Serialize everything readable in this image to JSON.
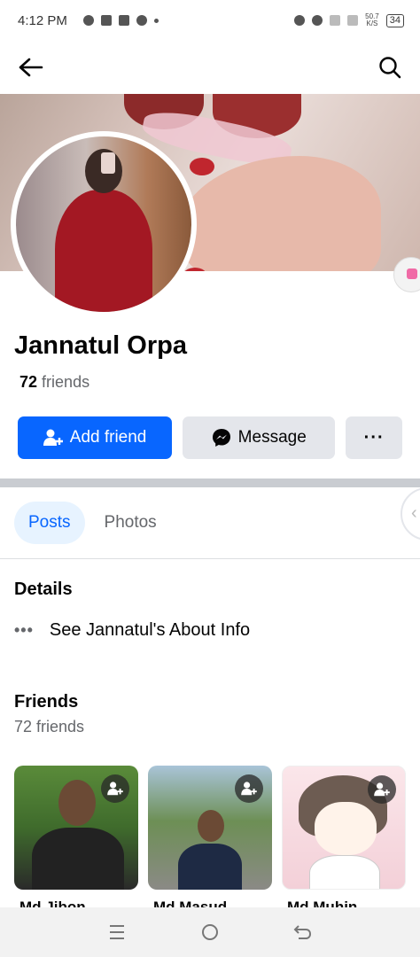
{
  "status_bar": {
    "time": "4:12 PM",
    "net_speed_value": "50.7",
    "net_speed_unit": "K/S",
    "battery": "34"
  },
  "nav": {
    "back_icon": "arrow-left-icon",
    "search_icon": "search-icon"
  },
  "profile": {
    "name": "Jannatul Orpa",
    "friends_count": "72",
    "friends_word": "friends"
  },
  "actions": {
    "add_friend_label": "Add friend",
    "message_label": "Message",
    "more_label": "···"
  },
  "tabs": [
    {
      "label": "Posts",
      "active": true
    },
    {
      "label": "Photos",
      "active": false
    }
  ],
  "details": {
    "title": "Details",
    "about_label": "See Jannatul's About Info"
  },
  "friends": {
    "title": "Friends",
    "subtitle": "72 friends",
    "items": [
      {
        "name": "Md Jibon"
      },
      {
        "name": "Md Masud"
      },
      {
        "name": "Md Muhin"
      }
    ]
  },
  "colors": {
    "primary": "#0866ff",
    "secondary_button": "#e4e6eb",
    "active_tab_bg": "#e7f3ff"
  }
}
